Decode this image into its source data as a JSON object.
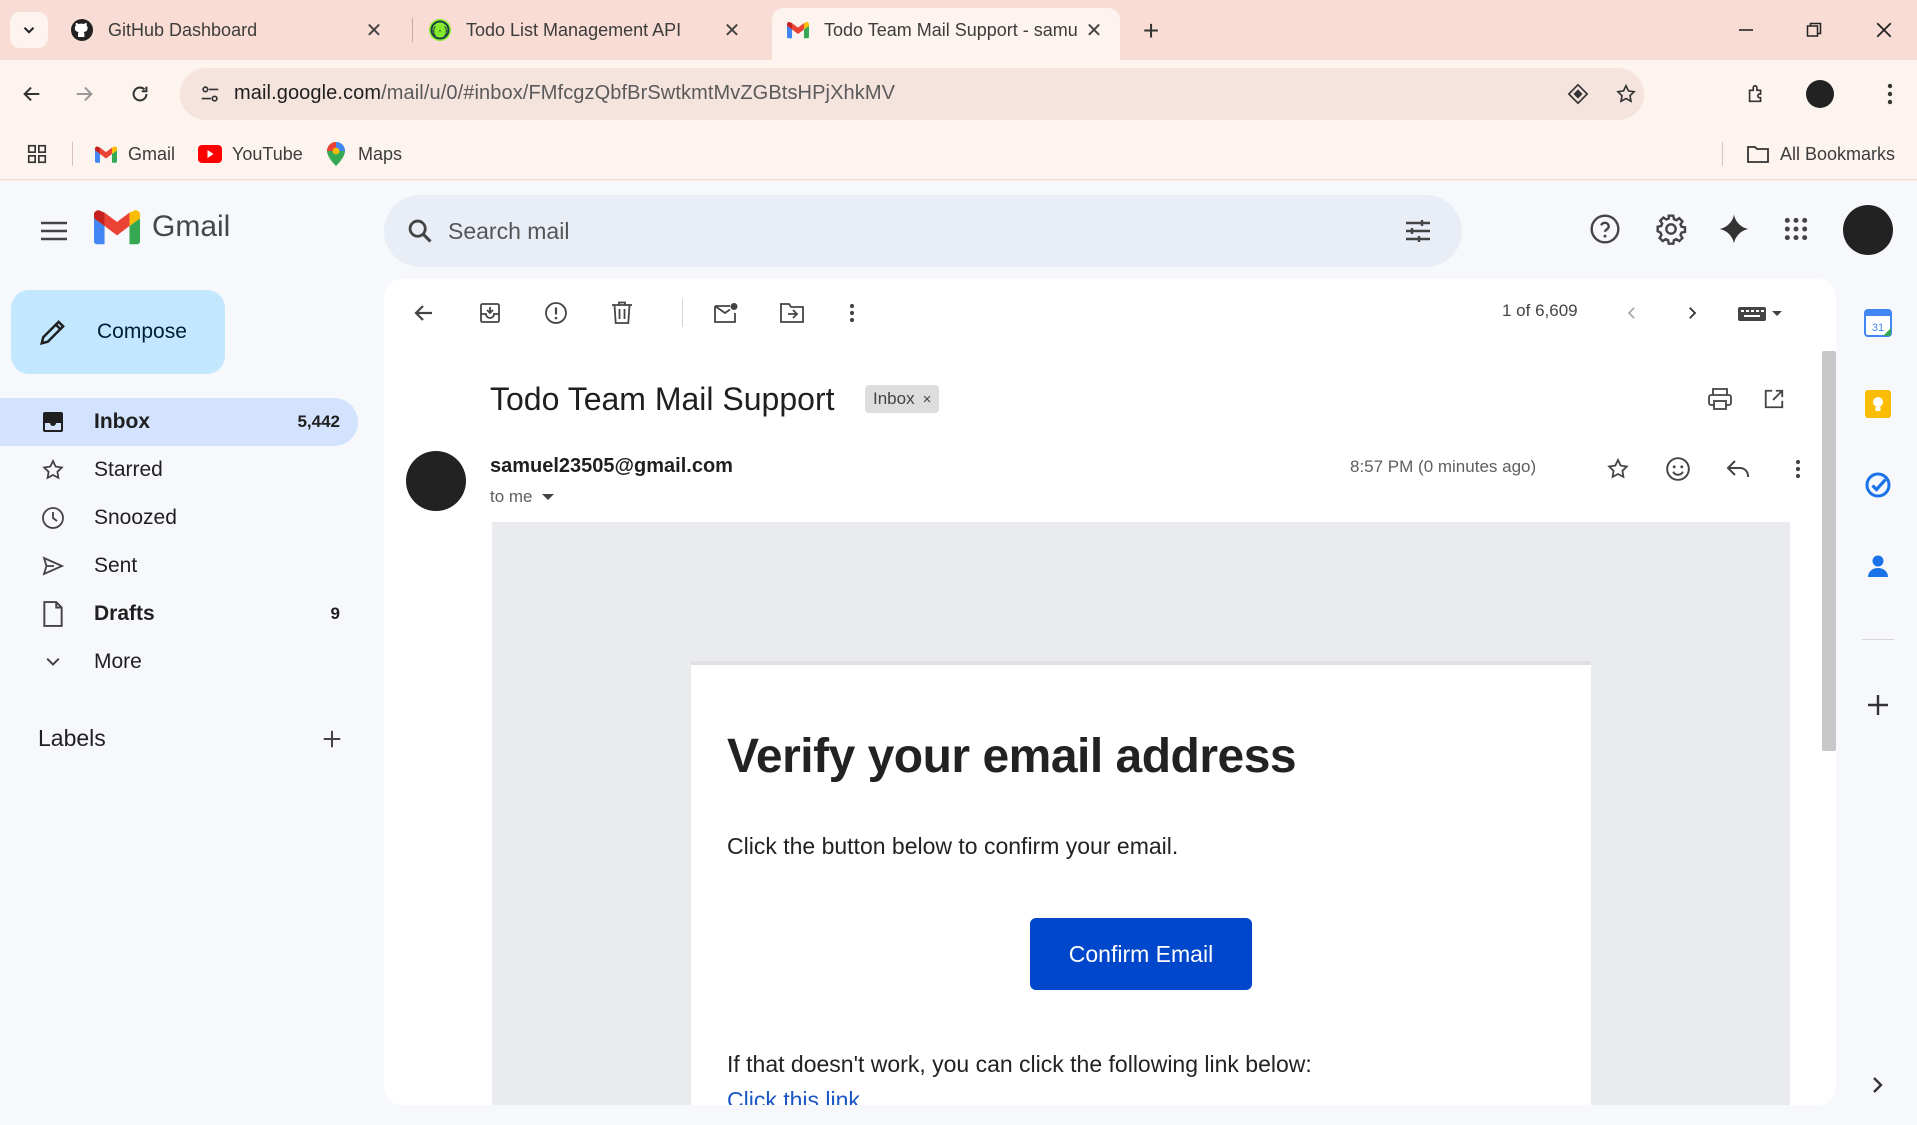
{
  "browser": {
    "tabs": [
      {
        "title": "GitHub Dashboard",
        "active": false
      },
      {
        "title": "Todo List Management API",
        "active": false
      },
      {
        "title": "Todo Team Mail Support - samu",
        "active": true
      }
    ],
    "url_host": "mail.google.com",
    "url_path": "/mail/u/0/#inbox/FMfcgzQbfBrSwtkmtMvZGBtsHPjXhkMV",
    "bookmarks": [
      "Gmail",
      "YouTube",
      "Maps"
    ],
    "all_bookmarks": "All Bookmarks"
  },
  "gmail": {
    "logo_text": "Gmail",
    "search_placeholder": "Search mail",
    "compose_label": "Compose",
    "nav": [
      {
        "label": "Inbox",
        "count": "5,442"
      },
      {
        "label": "Starred",
        "count": ""
      },
      {
        "label": "Snoozed",
        "count": ""
      },
      {
        "label": "Sent",
        "count": ""
      },
      {
        "label": "Drafts",
        "count": "9"
      },
      {
        "label": "More",
        "count": ""
      }
    ],
    "labels_heading": "Labels"
  },
  "message": {
    "pager": "1 of 6,609",
    "subject": "Todo Team Mail Support",
    "label_chip": "Inbox",
    "label_chip_close": "×",
    "sender": "samuel23505@gmail.com",
    "recipient": "to me",
    "time": "8:57 PM (0 minutes ago)"
  },
  "email": {
    "title": "Verify your email address",
    "body": "Click the button below to confirm your email.",
    "button": "Confirm Email",
    "alt_text": "If that doesn't work, you can click the following link below:",
    "link": "Click this link"
  },
  "colors": {
    "tabstrip": "#f9dcd3",
    "compose": "#c2e7ff",
    "active_nav": "#d3e3fd",
    "confirm_button": "#0047cc",
    "link": "#1a56c4"
  }
}
